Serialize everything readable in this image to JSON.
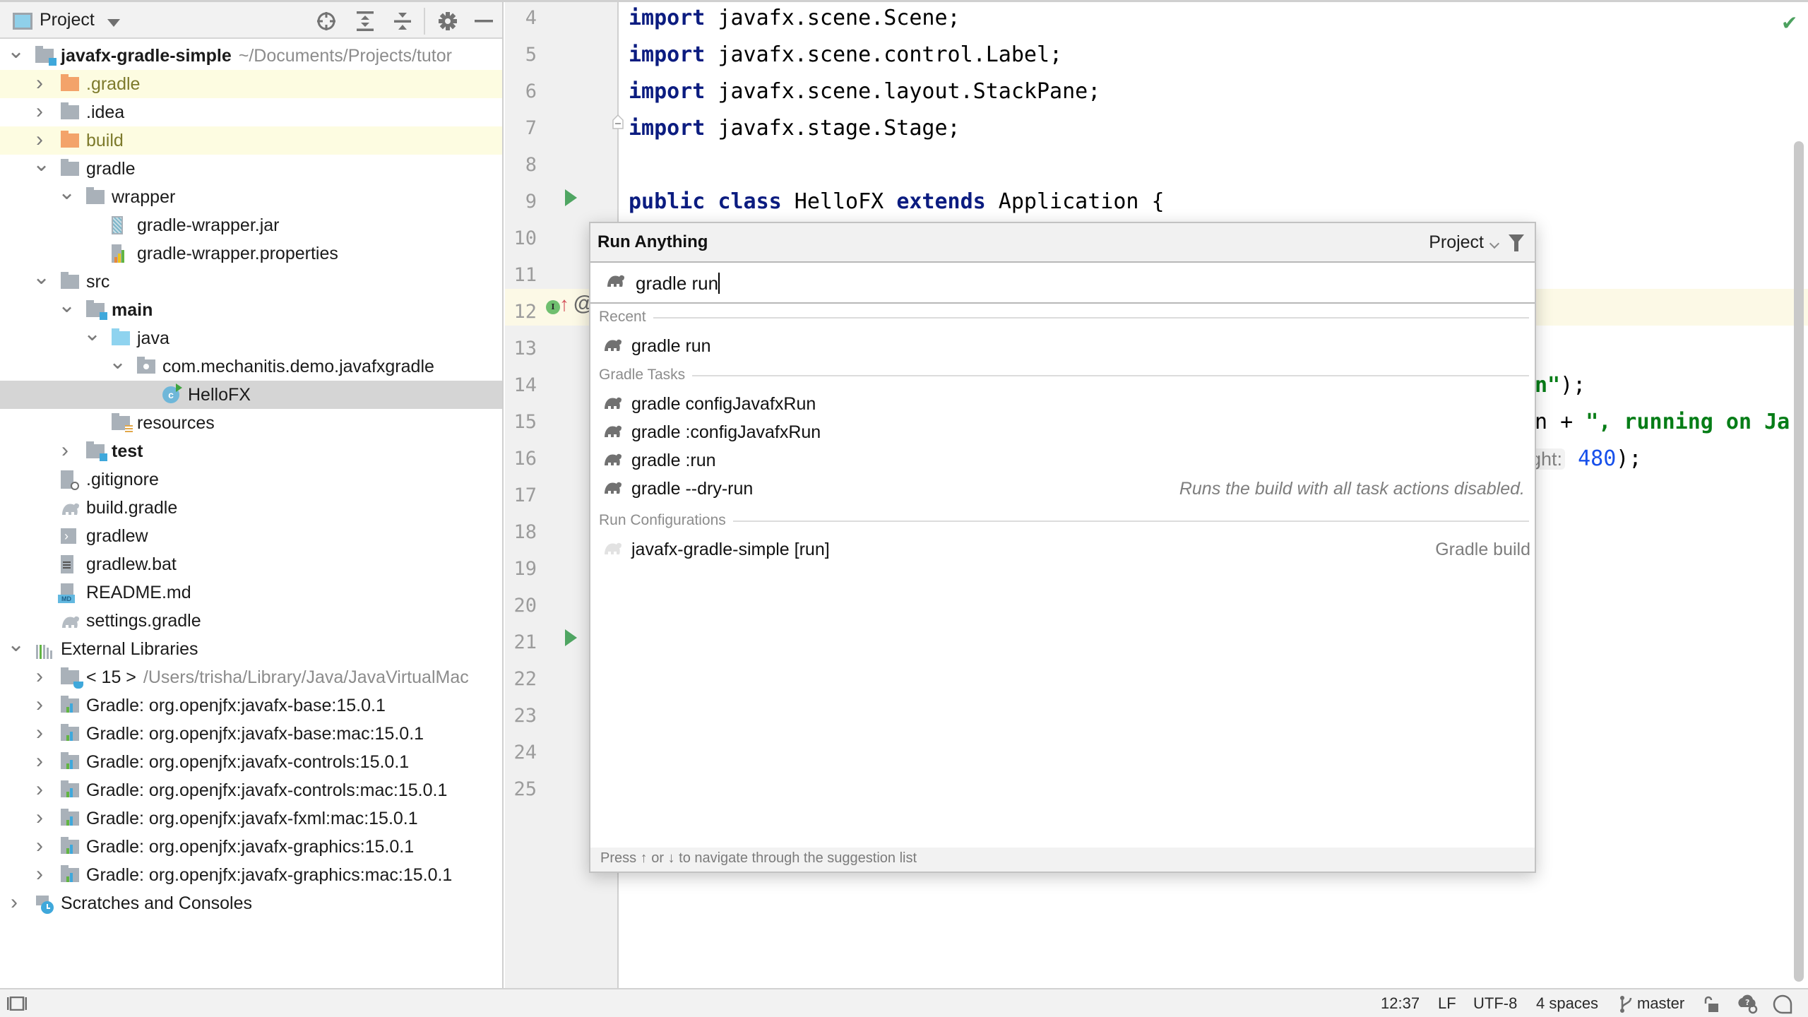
{
  "project_panel": {
    "title": "Project",
    "toolbar": [
      {
        "name": "locate-file-icon",
        "tooltip": "Select Opened File"
      },
      {
        "name": "expand-all-icon",
        "tooltip": "Expand All"
      },
      {
        "name": "collapse-all-icon",
        "tooltip": "Collapse All"
      },
      {
        "name": "gear-icon",
        "tooltip": "Options"
      },
      {
        "name": "hide-icon",
        "tooltip": "Hide"
      }
    ],
    "tree": [
      {
        "label": "javafx-gradle-simple",
        "path": "~/Documents/Projects/tutor",
        "depth": 0,
        "expanded": true,
        "icon": "module-folder-icon",
        "bold": true
      },
      {
        "label": ".gradle",
        "depth": 1,
        "expanded": false,
        "icon": "excluded-folder-icon",
        "excluded": true
      },
      {
        "label": ".idea",
        "depth": 1,
        "expanded": false,
        "icon": "folder-icon"
      },
      {
        "label": "build",
        "depth": 1,
        "expanded": false,
        "icon": "excluded-folder-icon",
        "excluded": true
      },
      {
        "label": "gradle",
        "depth": 1,
        "expanded": true,
        "icon": "folder-icon"
      },
      {
        "label": "wrapper",
        "depth": 2,
        "expanded": true,
        "icon": "folder-icon"
      },
      {
        "label": "gradle-wrapper.jar",
        "depth": 3,
        "icon": "jar-file-icon"
      },
      {
        "label": "gradle-wrapper.properties",
        "depth": 3,
        "icon": "properties-file-icon"
      },
      {
        "label": "src",
        "depth": 1,
        "expanded": true,
        "icon": "folder-icon"
      },
      {
        "label": "main",
        "depth": 2,
        "expanded": true,
        "icon": "module-folder-icon",
        "bold": true
      },
      {
        "label": "java",
        "depth": 3,
        "expanded": true,
        "icon": "source-root-icon"
      },
      {
        "label": "com.mechanitis.demo.javafxgradle",
        "depth": 4,
        "expanded": true,
        "icon": "package-icon"
      },
      {
        "label": "HelloFX",
        "depth": 5,
        "icon": "java-class-icon",
        "selected": true
      },
      {
        "label": "resources",
        "depth": 3,
        "icon": "resources-root-icon"
      },
      {
        "label": "test",
        "depth": 2,
        "expanded": false,
        "icon": "module-folder-icon",
        "bold": true
      },
      {
        "label": ".gitignore",
        "depth": 1,
        "icon": "gitignore-file-icon"
      },
      {
        "label": "build.gradle",
        "depth": 1,
        "icon": "gradle-file-icon"
      },
      {
        "label": "gradlew",
        "depth": 1,
        "icon": "shell-file-icon"
      },
      {
        "label": "gradlew.bat",
        "depth": 1,
        "icon": "text-file-icon"
      },
      {
        "label": "README.md",
        "depth": 1,
        "icon": "markdown-file-icon"
      },
      {
        "label": "settings.gradle",
        "depth": 1,
        "icon": "gradle-file-icon"
      },
      {
        "label": "External Libraries",
        "depth": 0,
        "expanded": true,
        "icon": "libraries-icon"
      },
      {
        "label": "< 15 >",
        "path": "/Users/trisha/Library/Java/JavaVirtualMac",
        "depth": 1,
        "expanded": false,
        "icon": "jdk-icon"
      },
      {
        "label": "Gradle: org.openjfx:javafx-base:15.0.1",
        "depth": 1,
        "expanded": false,
        "icon": "library-icon"
      },
      {
        "label": "Gradle: org.openjfx:javafx-base:mac:15.0.1",
        "depth": 1,
        "expanded": false,
        "icon": "library-icon"
      },
      {
        "label": "Gradle: org.openjfx:javafx-controls:15.0.1",
        "depth": 1,
        "expanded": false,
        "icon": "library-icon"
      },
      {
        "label": "Gradle: org.openjfx:javafx-controls:mac:15.0.1",
        "depth": 1,
        "expanded": false,
        "icon": "library-icon"
      },
      {
        "label": "Gradle: org.openjfx:javafx-fxml:mac:15.0.1",
        "depth": 1,
        "expanded": false,
        "icon": "library-icon"
      },
      {
        "label": "Gradle: org.openjfx:javafx-graphics:15.0.1",
        "depth": 1,
        "expanded": false,
        "icon": "library-icon"
      },
      {
        "label": "Gradle: org.openjfx:javafx-graphics:mac:15.0.1",
        "depth": 1,
        "expanded": false,
        "icon": "library-icon"
      },
      {
        "label": "Scratches and Consoles",
        "depth": 0,
        "expanded": false,
        "icon": "scratches-icon"
      }
    ]
  },
  "editor": {
    "line_numbers": [
      "4",
      "5",
      "6",
      "7",
      "8",
      "9",
      "10",
      "11",
      "12",
      "13",
      "14",
      "15",
      "16",
      "17",
      "18",
      "19",
      "20",
      "21",
      "22",
      "23",
      "24",
      "25"
    ],
    "code_lines": [
      {
        "line": "4",
        "tokens": [
          {
            "t": "import",
            "c": "kw"
          },
          {
            "t": " javafx.scene.Scene;"
          }
        ]
      },
      {
        "line": "5",
        "tokens": [
          {
            "t": "import",
            "c": "kw"
          },
          {
            "t": " javafx.scene.control.Label;"
          }
        ]
      },
      {
        "line": "6",
        "tokens": [
          {
            "t": "import",
            "c": "kw"
          },
          {
            "t": " javafx.scene.layout.StackPane;"
          }
        ]
      },
      {
        "line": "7",
        "tokens": [
          {
            "t": "import",
            "c": "kw"
          },
          {
            "t": " javafx.stage.Stage;"
          }
        ]
      },
      {
        "line": "8",
        "tokens": []
      },
      {
        "line": "9",
        "tokens": [
          {
            "t": "public",
            "c": "kw"
          },
          {
            "t": " "
          },
          {
            "t": "class",
            "c": "kw"
          },
          {
            "t": " HelloFX "
          },
          {
            "t": "extends",
            "c": "kw"
          },
          {
            "t": " Application {"
          }
        ]
      }
    ],
    "visible_fragments": [
      {
        "line": "14",
        "tokens": [
          {
            "t": "n\"",
            "c": "str"
          },
          {
            "t": ");"
          }
        ]
      },
      {
        "line": "15",
        "tokens": [
          {
            "t": "n + "
          },
          {
            "t": "\", running on Ja",
            "c": "str"
          }
        ]
      },
      {
        "line": "16",
        "tokens": [
          {
            "t": "ght:",
            "c": "hint"
          },
          {
            "t": " "
          },
          {
            "t": "480",
            "c": "num"
          },
          {
            "t": ");"
          }
        ]
      }
    ],
    "current_line": "12",
    "run_markers": [
      "9",
      "21"
    ],
    "inspection_status": "ok"
  },
  "run_anything": {
    "title": "Run Anything",
    "scope": "Project",
    "query": "gradle run",
    "sections": [
      {
        "label": "Recent",
        "items": [
          {
            "label": "gradle run",
            "icon": "gradle-elephant-icon"
          }
        ]
      },
      {
        "label": "Gradle Tasks",
        "items": [
          {
            "label": "gradle configJavafxRun",
            "icon": "gradle-elephant-icon"
          },
          {
            "label": "gradle :configJavafxRun",
            "icon": "gradle-elephant-icon"
          },
          {
            "label": "gradle :run",
            "icon": "gradle-elephant-icon"
          },
          {
            "label": "gradle --dry-run",
            "icon": "gradle-elephant-icon",
            "description": "Runs the build with all task actions disabled."
          }
        ]
      },
      {
        "label": "Run Configurations",
        "items": [
          {
            "label": "javafx-gradle-simple [run]",
            "icon": "gradle-config-icon",
            "type": "Gradle build"
          }
        ]
      }
    ],
    "footer": "Press ↑ or ↓ to navigate through the suggestion list"
  },
  "status_bar": {
    "position": "12:37",
    "line_separator": "LF",
    "encoding": "UTF-8",
    "indent": "4 spaces",
    "branch": "master"
  },
  "colors": {
    "keyword": "#0b1c80",
    "string": "#067d17",
    "number": "#1750eb",
    "run_marker": "#4fa562",
    "excluded_bg": "#fdfce1",
    "selected_bg": "#d5d5d5"
  }
}
